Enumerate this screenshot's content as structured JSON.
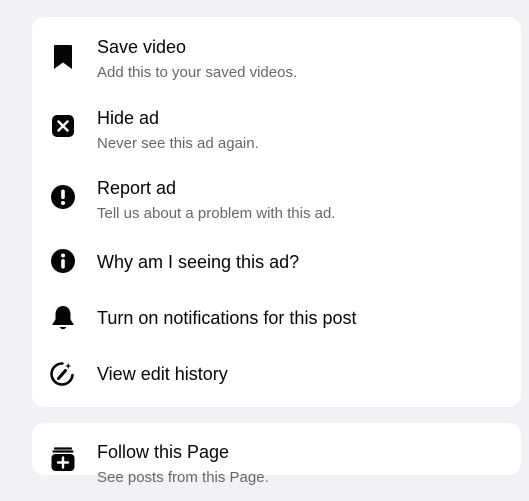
{
  "menu": {
    "items": [
      {
        "title": "Save video",
        "subtitle": "Add this to your saved videos.",
        "icon": "bookmark-icon"
      },
      {
        "title": "Hide ad",
        "subtitle": "Never see this ad again.",
        "icon": "close-box-icon"
      },
      {
        "title": "Report ad",
        "subtitle": "Tell us about a problem with this ad.",
        "icon": "exclamation-circle-icon"
      },
      {
        "title": "Why am I seeing this ad?",
        "icon": "info-circle-icon"
      },
      {
        "title": "Turn on notifications for this post",
        "icon": "bell-icon"
      },
      {
        "title": "View edit history",
        "icon": "edit-history-icon"
      }
    ]
  },
  "follow": {
    "title": "Follow this Page",
    "subtitle": "See posts from this Page.",
    "icon": "follow-page-icon"
  },
  "colors": {
    "background": "#f0f2f5",
    "card": "#ffffff",
    "title_text": "#050505",
    "subtitle_text": "#65676b",
    "icon": "#050505"
  }
}
